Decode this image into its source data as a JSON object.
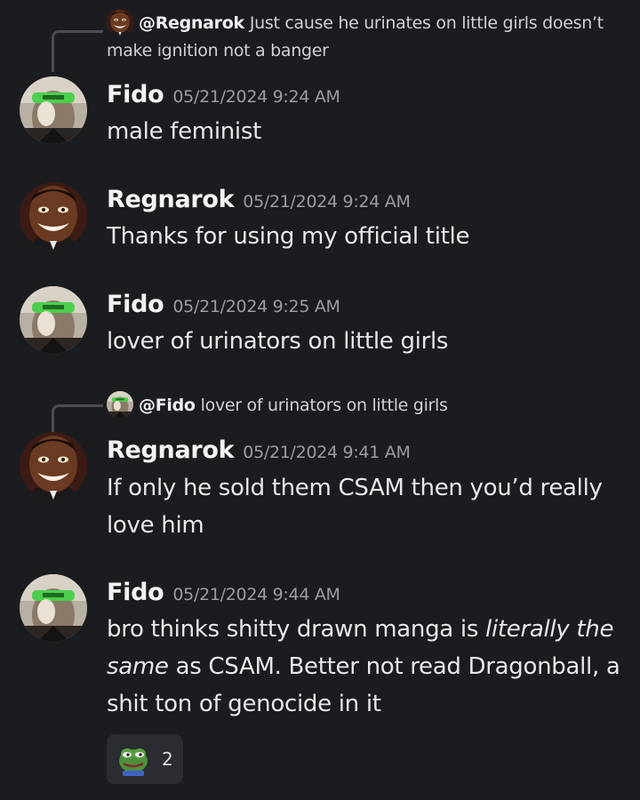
{
  "messages": [
    {
      "reply": {
        "mention": "@Regnarok",
        "text": "Just cause he urinates on little girls doesn’t make ignition not a banger"
      },
      "username": "Fido",
      "timestamp": "05/21/2024 9:24 AM",
      "content": "male feminist"
    },
    {
      "username": "Regnarok",
      "timestamp": "05/21/2024 9:24 AM",
      "content": "Thanks for using my official title"
    },
    {
      "username": "Fido",
      "timestamp": "05/21/2024 9:25 AM",
      "content": "lover of urinators on little girls"
    },
    {
      "reply": {
        "mention": "@Fido",
        "text": "lover of urinators on little girls"
      },
      "username": "Regnarok",
      "timestamp": "05/21/2024 9:41 AM",
      "content": "If only he sold them CSAM then you’d really love him"
    },
    {
      "username": "Fido",
      "timestamp": "05/21/2024 9:44 AM",
      "content_parts": {
        "before": "bro thinks shitty drawn manga is ",
        "italic": "literally the same",
        "after": " as CSAM. Better not read Dragonball, a shit ton of genocide in it"
      },
      "reaction": {
        "emoji": "pepe-frog-emoji",
        "count": "2"
      }
    }
  ],
  "colors": {
    "background": "#1b1c20",
    "username": "#f2f3f5",
    "timestamp": "#9a9ca4",
    "reaction_bg": "#2a2c31"
  }
}
